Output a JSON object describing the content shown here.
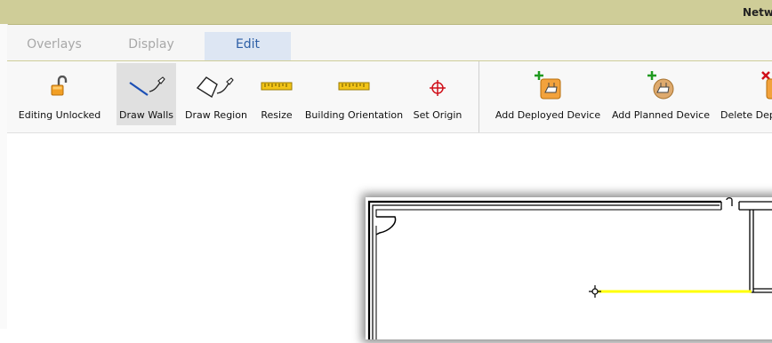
{
  "window": {
    "title": "Netw"
  },
  "tabs": [
    {
      "label": "Overlays",
      "active": false
    },
    {
      "label": "Display",
      "active": false
    },
    {
      "label": "Edit",
      "active": true
    }
  ],
  "tools": [
    {
      "label": "Editing Unlocked",
      "icon": "unlocked-padlock-icon"
    },
    {
      "label": "Draw Walls",
      "icon": "draw-walls-icon",
      "selected": true
    },
    {
      "label": "Draw Region",
      "icon": "draw-region-icon"
    },
    {
      "label": "Resize",
      "icon": "ruler-icon"
    },
    {
      "label": "Building Orientation",
      "icon": "ruler-icon"
    },
    {
      "label": "Set Origin",
      "icon": "crosshair-icon"
    }
  ],
  "device_tools": [
    {
      "label": "Add Deployed Device",
      "icon": "add-deployed-device-icon"
    },
    {
      "label": "Add Planned Device",
      "icon": "add-planned-device-icon"
    },
    {
      "label": "Delete Dep",
      "icon": "delete-device-icon"
    }
  ],
  "colors": {
    "accent": "#2d5fa6",
    "titlebar": "#cfcd98",
    "wall_draft": "#ffff00"
  }
}
